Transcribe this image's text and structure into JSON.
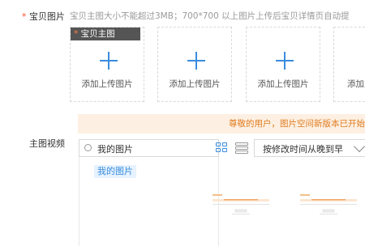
{
  "images_row": {
    "required_mark": "*",
    "label": "宝贝图片",
    "hint": "宝贝主图大小不能超过3MB；700*700 以上图片上传后宝贝详情页自动提"
  },
  "main_tag": {
    "star": "*",
    "text": "宝贝主图"
  },
  "upload_boxes": [
    {
      "label": "添加上传图片"
    },
    {
      "label": "添加上传图片"
    },
    {
      "label": "添加上传图片"
    },
    {
      "label": "添加上传图片"
    }
  ],
  "video_row": {
    "label": "主图视频"
  },
  "notice": {
    "text": "尊敬的用户，图片空间新版本已开始"
  },
  "search": {
    "value": "我的图片"
  },
  "tree": {
    "selected_item": "我的图片"
  },
  "sort": {
    "value": "按修改时间从晚到早"
  },
  "colors": {
    "accent": "#3a8dde",
    "required": "#ff4d2d",
    "notice_bg": "#fdf0e2",
    "notice_text": "#e07b1f"
  },
  "icons": [
    "plus-icon",
    "search-icon",
    "grid-view-icon",
    "list-view-icon",
    "chevron-down-icon"
  ]
}
